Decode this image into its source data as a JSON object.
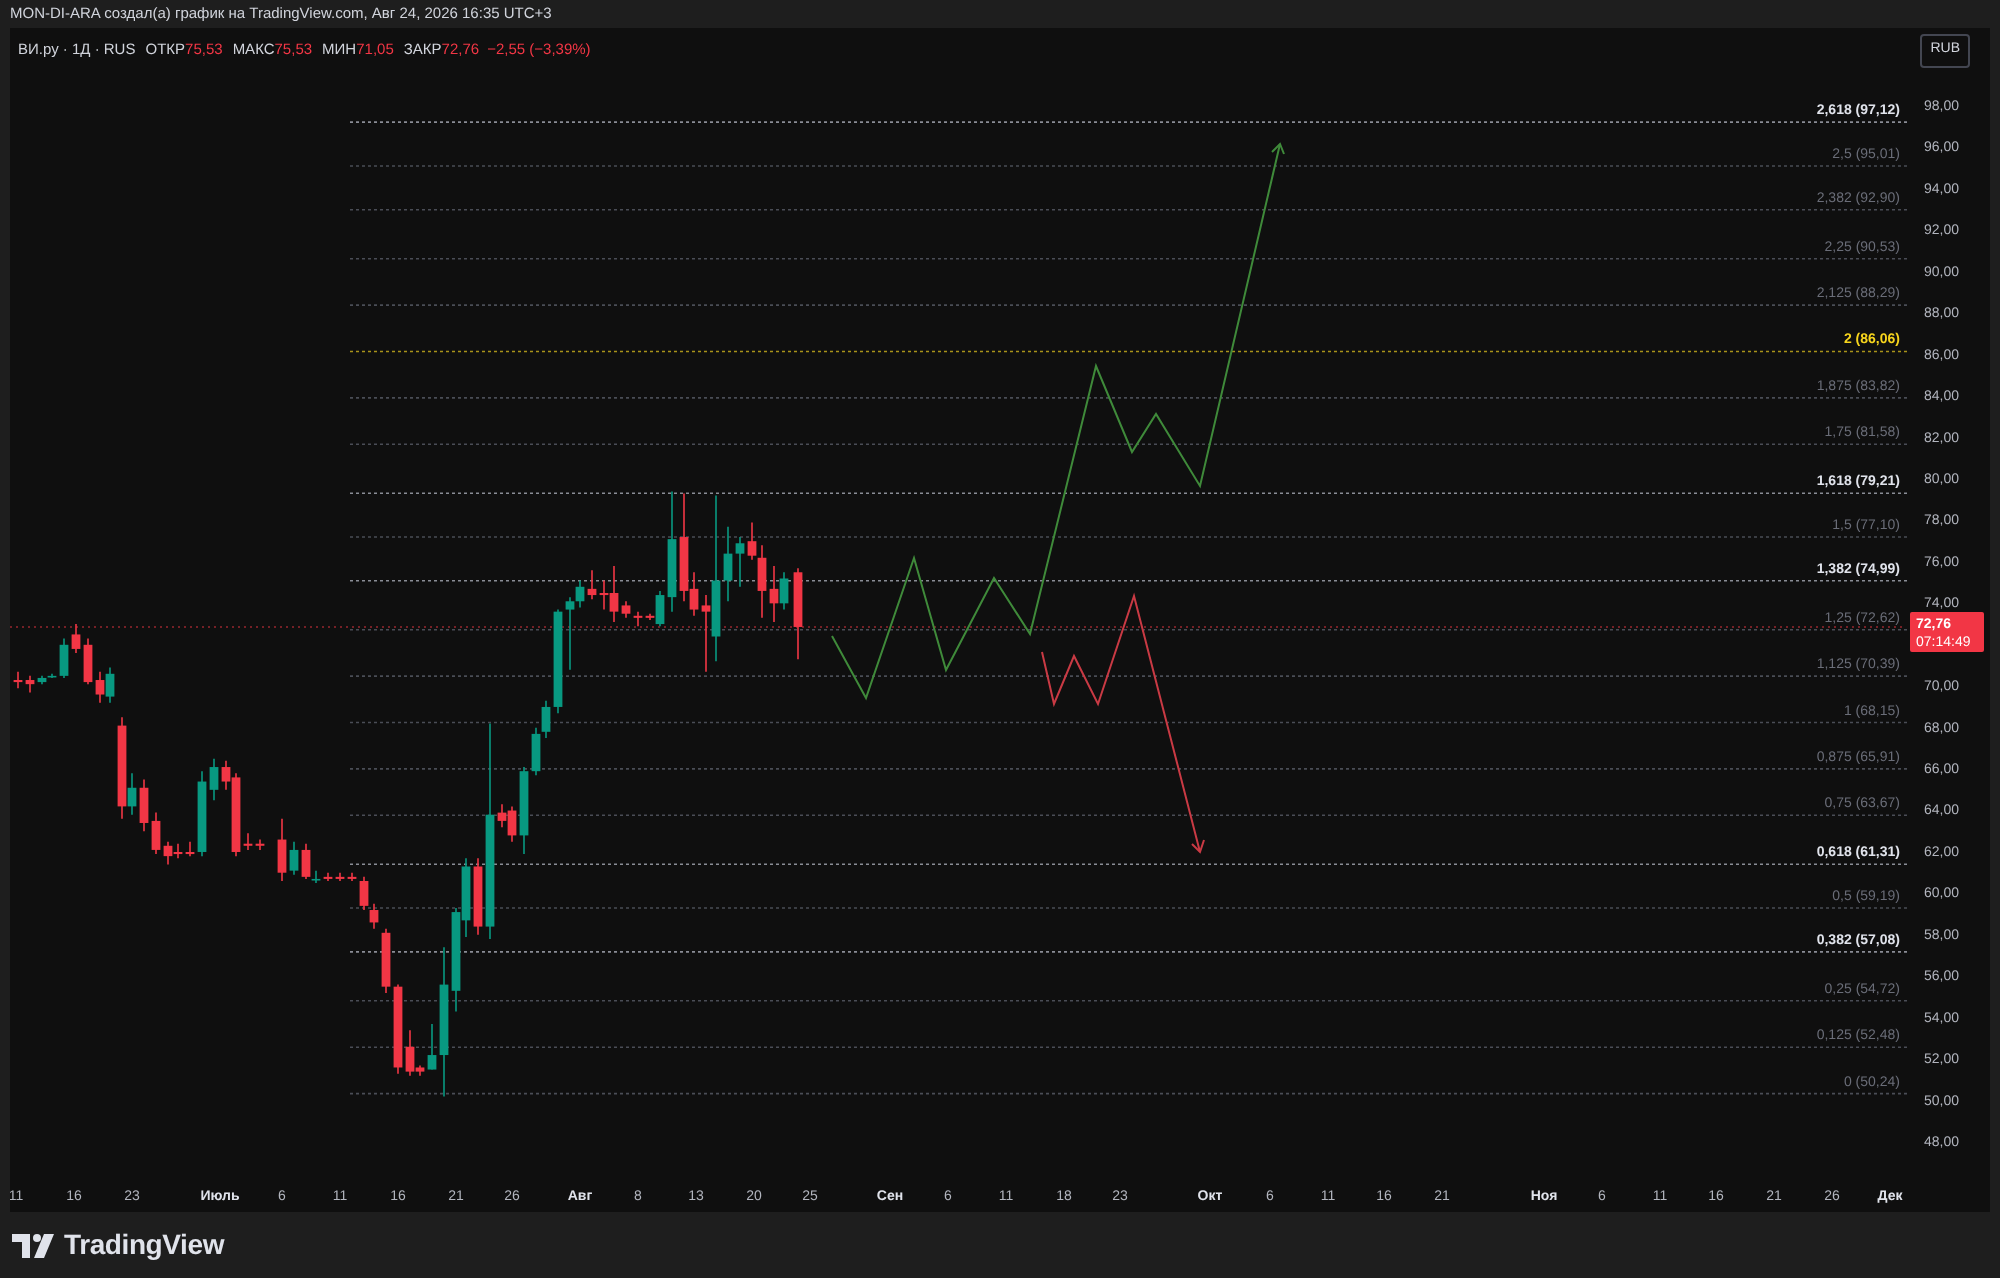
{
  "attribution": "MON-DI-ARA создал(а) график на TradingView.com, Авг 24, 2026 16:35 UTC+3",
  "legend": {
    "symbol": "ВИ.ру · 1Д · RUS",
    "fields": [
      {
        "label": "ОТКР",
        "value": "75,53"
      },
      {
        "label": "МАКС",
        "value": "75,53"
      },
      {
        "label": "МИН",
        "value": "71,05"
      },
      {
        "label": "ЗАКР",
        "value": "72,76"
      }
    ],
    "change": "−2,55 (−3,39%)"
  },
  "currency": "RUB",
  "fib_levels": [
    {
      "label": "2,618 (97,12)",
      "kind": "major"
    },
    {
      "label": "2,5 (95,01)",
      "kind": "minor"
    },
    {
      "label": "2,382 (92,90)",
      "kind": "minor"
    },
    {
      "label": "2,25 (90,53)",
      "kind": "minor"
    },
    {
      "label": "2,125 (88,29)",
      "kind": "minor"
    },
    {
      "label": "2 (86,06)",
      "kind": "highlight"
    },
    {
      "label": "1,875 (83,82)",
      "kind": "minor"
    },
    {
      "label": "1,75 (81,58)",
      "kind": "minor"
    },
    {
      "label": "1,618 (79,21)",
      "kind": "major"
    },
    {
      "label": "1,5 (77,10)",
      "kind": "minor"
    },
    {
      "label": "1,382 (74,99)",
      "kind": "major"
    },
    {
      "label": "1,25 (72,62)",
      "kind": "minor"
    },
    {
      "label": "1,125 (70,39)",
      "kind": "minor"
    },
    {
      "label": "1 (68,15)",
      "kind": "minor"
    },
    {
      "label": "0,875 (65,91)",
      "kind": "minor"
    },
    {
      "label": "0,75 (63,67)",
      "kind": "minor"
    },
    {
      "label": "0,618 (61,31)",
      "kind": "major"
    },
    {
      "label": "0,5 (59,19)",
      "kind": "minor"
    },
    {
      "label": "0,382 (57,08)",
      "kind": "major"
    },
    {
      "label": "0,25 (54,72)",
      "kind": "minor"
    },
    {
      "label": "0,125 (52,48)",
      "kind": "minor"
    },
    {
      "label": "0 (50,24)",
      "kind": "minor"
    }
  ],
  "price_axis": [
    "98,00",
    "96,00",
    "94,00",
    "92,00",
    "90,00",
    "88,00",
    "86,00",
    "84,00",
    "82,00",
    "80,00",
    "78,00",
    "76,00",
    "74,00",
    "70,00",
    "68,00",
    "66,00",
    "64,00",
    "62,00",
    "60,00",
    "58,00",
    "56,00",
    "54,00",
    "52,00",
    "50,00",
    "48,00"
  ],
  "last_price": {
    "value": "72,76",
    "countdown": "07:14:49"
  },
  "time_axis": [
    {
      "label": "11",
      "kind": "day"
    },
    {
      "label": "16",
      "kind": "day"
    },
    {
      "label": "23",
      "kind": "day"
    },
    {
      "label": "Июль",
      "kind": "month"
    },
    {
      "label": "6",
      "kind": "day"
    },
    {
      "label": "11",
      "kind": "day"
    },
    {
      "label": "16",
      "kind": "day"
    },
    {
      "label": "21",
      "kind": "day"
    },
    {
      "label": "26",
      "kind": "day"
    },
    {
      "label": "Авг",
      "kind": "month"
    },
    {
      "label": "8",
      "kind": "day"
    },
    {
      "label": "13",
      "kind": "day"
    },
    {
      "label": "20",
      "kind": "day"
    },
    {
      "label": "25",
      "kind": "day"
    },
    {
      "label": "Сен",
      "kind": "month"
    },
    {
      "label": "6",
      "kind": "day"
    },
    {
      "label": "11",
      "kind": "day"
    },
    {
      "label": "18",
      "kind": "day"
    },
    {
      "label": "23",
      "kind": "day"
    },
    {
      "label": "Окт",
      "kind": "month"
    },
    {
      "label": "6",
      "kind": "day"
    },
    {
      "label": "11",
      "kind": "day"
    },
    {
      "label": "16",
      "kind": "day"
    },
    {
      "label": "21",
      "kind": "day"
    },
    {
      "label": "Ноя",
      "kind": "month"
    },
    {
      "label": "6",
      "kind": "day"
    },
    {
      "label": "11",
      "kind": "day"
    },
    {
      "label": "16",
      "kind": "day"
    },
    {
      "label": "21",
      "kind": "day"
    },
    {
      "label": "26",
      "kind": "day"
    },
    {
      "label": "Дек",
      "kind": "month"
    }
  ],
  "brand": "TradingView"
}
